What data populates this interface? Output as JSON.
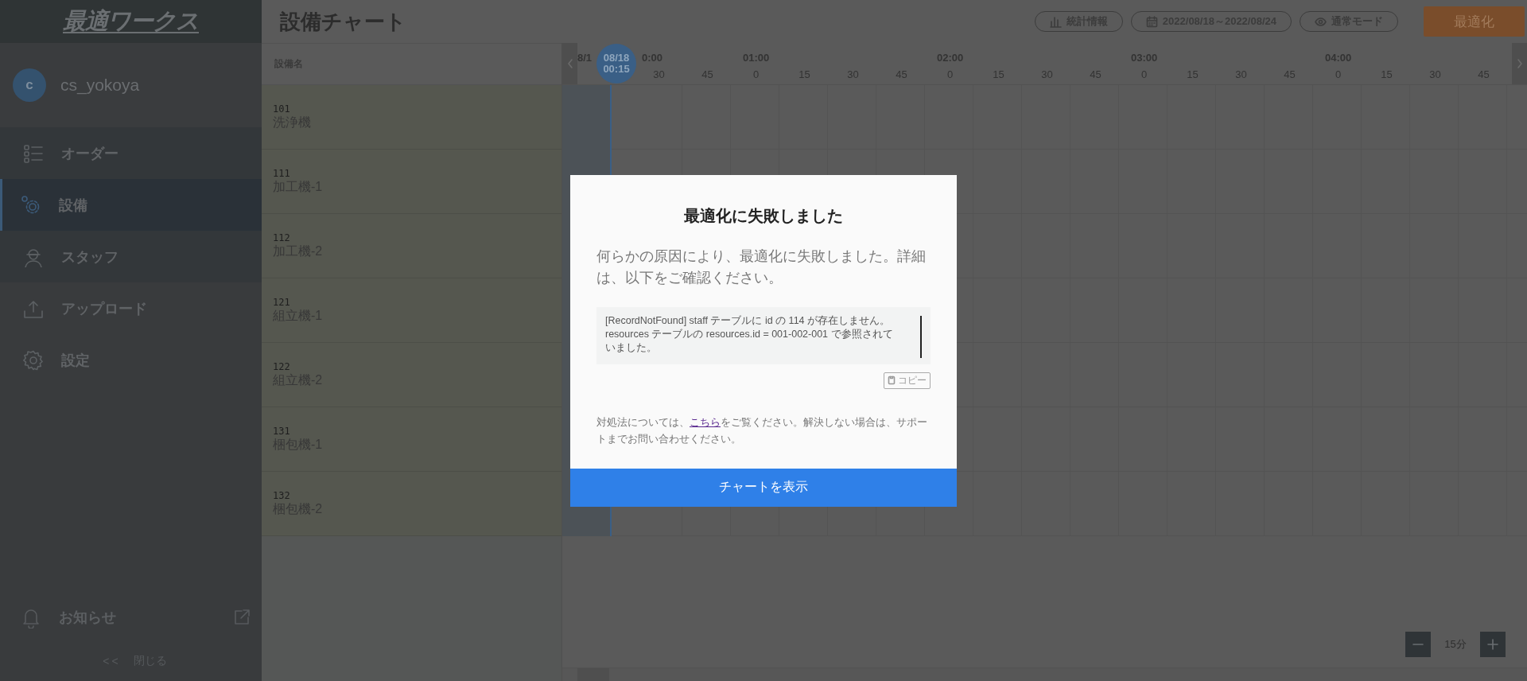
{
  "sidebar": {
    "logo": "最適ワークス",
    "user": {
      "initial": "c",
      "name": "cs_yokoya"
    },
    "nav": [
      {
        "label": "オーダー",
        "selected": false
      },
      {
        "label": "設備",
        "selected": true
      },
      {
        "label": "スタッフ",
        "selected": false
      },
      {
        "label": "アップロード",
        "selected": false
      },
      {
        "label": "設定",
        "selected": false
      }
    ],
    "notifications": "お知らせ",
    "collapse": {
      "arrows": "<<",
      "label": "閉じる"
    }
  },
  "header": {
    "title": "設備チャート",
    "buttons": [
      {
        "label": "統計情報"
      },
      {
        "label": "2022/08/18～2022/08/24"
      },
      {
        "label": "通常モード"
      }
    ],
    "primary": "最適化"
  },
  "chart": {
    "column_header": "設備名",
    "hours": [
      "8/1",
      "0:00",
      "01:00",
      "02:00",
      "03:00",
      "04:00"
    ],
    "minutes": [
      "30",
      "45",
      "0",
      "15",
      "30",
      "45",
      "0",
      "15",
      "30",
      "45",
      "0",
      "15",
      "30",
      "45",
      "0",
      "15",
      "30",
      "45"
    ],
    "current_time": {
      "date": "08/18",
      "time": "00:15"
    },
    "rows": [
      {
        "code": "101",
        "name": "洗浄機"
      },
      {
        "code": "111",
        "name": "加工機-1"
      },
      {
        "code": "112",
        "name": "加工機-2"
      },
      {
        "code": "121",
        "name": "組立機-1"
      },
      {
        "code": "122",
        "name": "組立機-2"
      },
      {
        "code": "131",
        "name": "梱包機-1"
      },
      {
        "code": "132",
        "name": "梱包機-2"
      }
    ],
    "zoom": "15分"
  },
  "dialog": {
    "title": "最適化に失敗しました",
    "message": "何らかの原因により、最適化に失敗しました。詳細は、以下をご確認ください。",
    "error": "[RecordNotFound] staff テーブルに id の 114 が存在しません。resources テーブルの resources.id = 001-002-001 で参照されていました。",
    "copy": "コピー",
    "note_before": "対処法については、",
    "link": "こちら",
    "note_after": "をご覧ください。解決しない場合は、サポートまでお問い合わせください。",
    "button": "チャートを表示"
  }
}
